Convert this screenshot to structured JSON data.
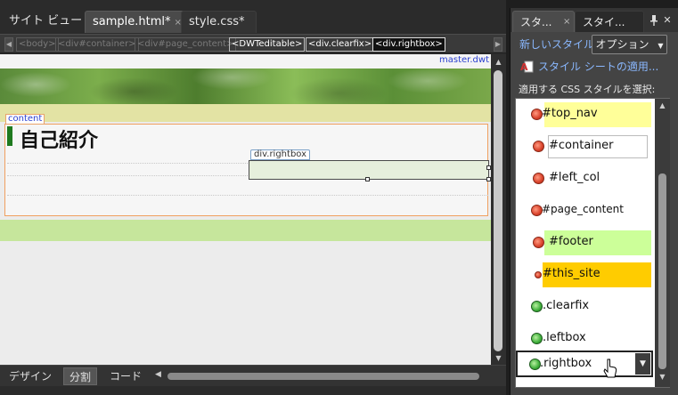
{
  "document_tabs": [
    {
      "label": "サイト ビュー",
      "active": false
    },
    {
      "label": "sample.html*",
      "active": true,
      "close": "×"
    },
    {
      "label": "style.css*",
      "active": false
    }
  ],
  "tag_selector": [
    "<body>",
    "<div#container>",
    "<div#page_content>",
    "<DWTeditable>",
    "<div.clearfix>",
    "<div.rightbox>"
  ],
  "design": {
    "master_label": "master.dwt",
    "content_region_label": "content",
    "page_heading": "自己紹介",
    "rightbox_label": "div.rightbox"
  },
  "view_buttons": [
    "デザイン",
    "分割",
    "コード"
  ],
  "panel": {
    "tabs": [
      "スタ...",
      "スタイ..."
    ],
    "tab_close": "×",
    "new_style_link": "新しいスタイル...",
    "options_button": "オプション",
    "attach_link": "スタイル シートの適用...",
    "select_label": "適用する CSS スタイルを選択:",
    "styles": [
      {
        "name": "#top_nav",
        "dot": "red",
        "highlight": "#ffff99"
      },
      {
        "name": "#container",
        "dot": "red",
        "highlight": "boxed"
      },
      {
        "name": "#left_col",
        "dot": "red",
        "highlight": ""
      },
      {
        "name": "#page_content",
        "dot": "red",
        "highlight": ""
      },
      {
        "name": "#footer",
        "dot": "red",
        "highlight": "#ccff99"
      },
      {
        "name": "#this_site",
        "dot": "red-small",
        "highlight": "#ffcc00"
      },
      {
        "name": ".clearfix",
        "dot": "green",
        "highlight": ""
      },
      {
        "name": ".leftbox",
        "dot": "green",
        "highlight": ""
      }
    ],
    "selected_style": ".rightbox"
  },
  "colors": {
    "accent_link": "#8ab8ff",
    "master_text": "#2a3fd0",
    "nav_strip": "#e3e3a4",
    "footer_strip": "#c6e69c",
    "heading_bar": "#1f7a1f"
  }
}
